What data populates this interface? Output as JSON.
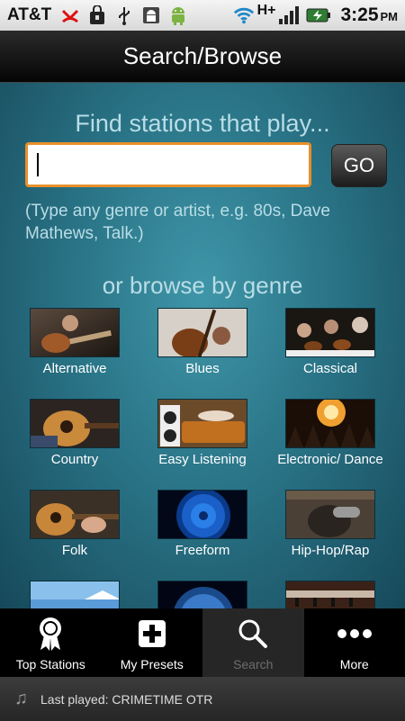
{
  "status": {
    "carrier": "AT&T",
    "network": "H+",
    "time": "3:25",
    "ampm": "PM"
  },
  "title": "Search/Browse",
  "search": {
    "prompt": "Find stations that play...",
    "value": "",
    "go_label": "GO",
    "hint": "(Type any genre or artist, e.g. 80s, Dave Mathews, Talk.)"
  },
  "browse": {
    "title": "or browse by genre",
    "genres": [
      {
        "label": "Alternative"
      },
      {
        "label": "Blues"
      },
      {
        "label": "Classical"
      },
      {
        "label": "Country"
      },
      {
        "label": "Easy Listening"
      },
      {
        "label": "Electronic/ Dance"
      },
      {
        "label": "Folk"
      },
      {
        "label": "Freeform"
      },
      {
        "label": "Hip-Hop/Rap"
      }
    ]
  },
  "nav": {
    "items": [
      {
        "label": "Top Stations"
      },
      {
        "label": "My Presets"
      },
      {
        "label": "Search"
      },
      {
        "label": "More"
      }
    ]
  },
  "last_played": "Last played: CRIMETIME OTR"
}
